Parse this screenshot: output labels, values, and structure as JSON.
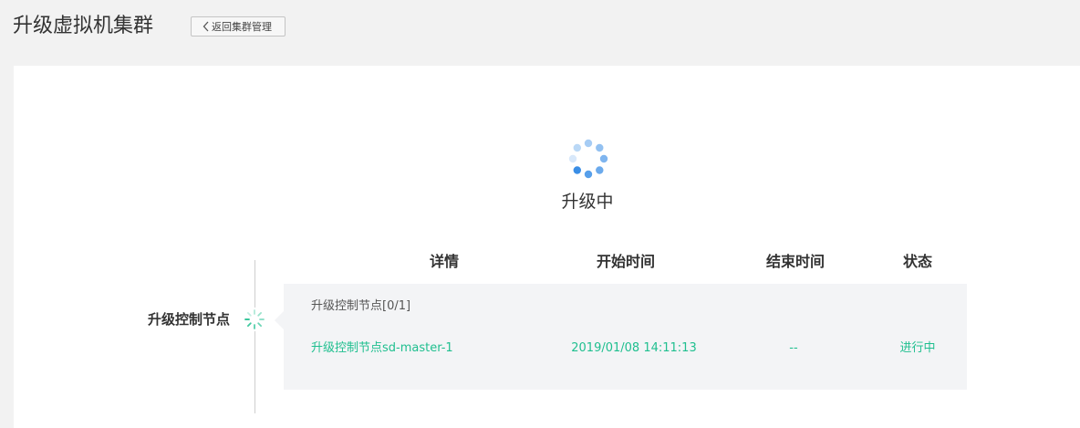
{
  "header": {
    "title": "升级虚拟机集群",
    "back_button_label": "返回集群管理"
  },
  "progress": {
    "status_label": "升级中"
  },
  "table": {
    "columns": {
      "detail": "详情",
      "start_time": "开始时间",
      "end_time": "结束时间",
      "status": "状态"
    }
  },
  "step": {
    "label": "升级控制节点",
    "group_title": "升级控制节点[0/1]",
    "row": {
      "detail": "升级控制节点sd-master-1",
      "start_time": "2019/01/08 14:11:13",
      "end_time": "--",
      "status": "进行中"
    }
  },
  "colors": {
    "accent_green": "#1fbf8f",
    "spinner_blue": "#3a8ee6",
    "panel_bg": "#ffffff",
    "page_bg": "#f2f2f2",
    "detail_bg": "#f3f4f6"
  },
  "icons": {
    "back": "chevron-left-icon",
    "main_spinner": "loading-spinner-icon",
    "step_spinner": "step-loading-icon"
  }
}
